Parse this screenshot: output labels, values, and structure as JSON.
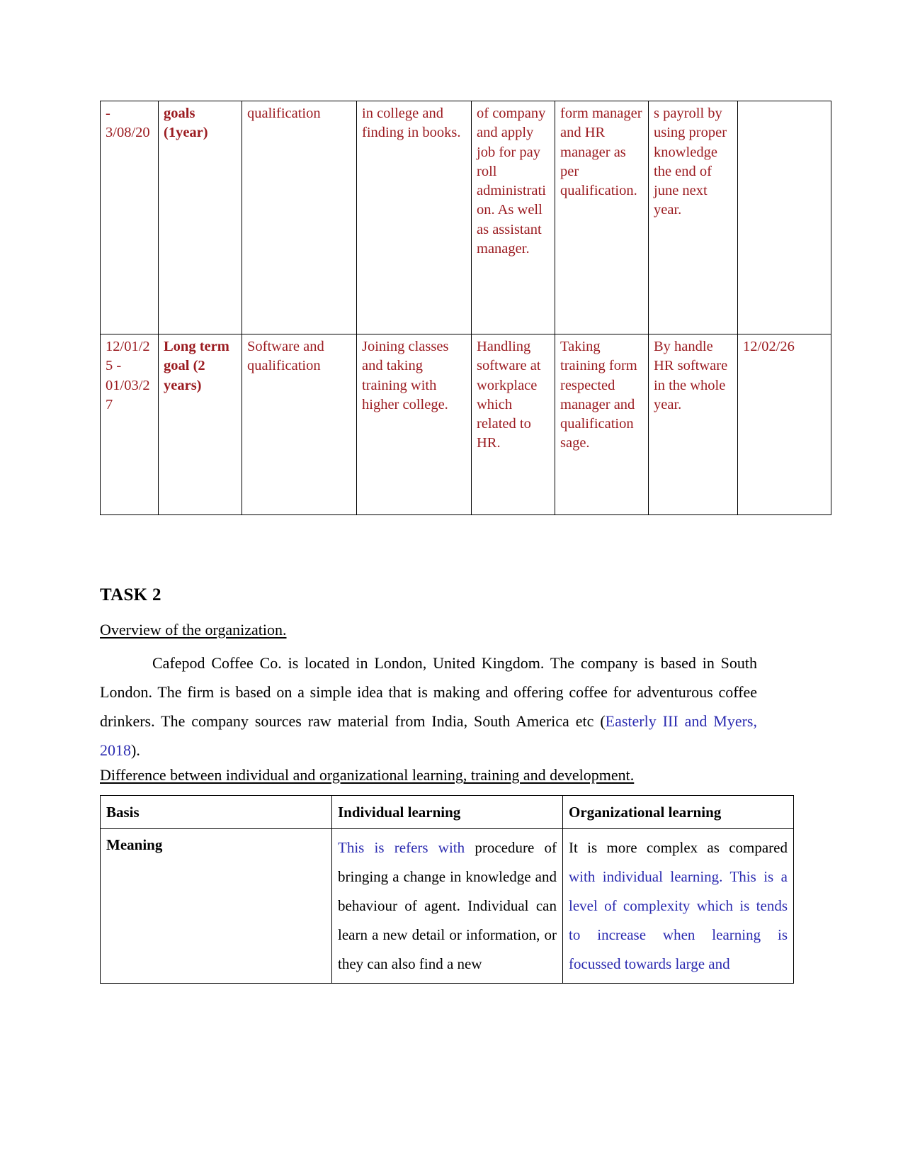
{
  "goals_table": {
    "rows": [
      {
        "name": "short-term-goal-row",
        "cells": [
          "-\n3/08/20",
          "goals (1year)",
          "qualification",
          "in college and finding in books.",
          "of company and apply job for pay roll administration. As well as assistant manager.",
          "form manager and HR manager as per qualification.",
          "s payroll by using proper knowledge the end of june next year.",
          ""
        ]
      },
      {
        "name": "long-term-goal-row",
        "cells": [
          "12/01/25 - 01/03/27",
          "Long term goal (2 years)",
          "Software and qualification",
          "Joining classes and taking training with higher college.",
          "Handling software at workplace which related to HR.",
          "Taking training form respected manager and qualification sage.",
          "By handle HR software in the whole year.",
          "12/02/26"
        ]
      }
    ]
  },
  "task": {
    "title": "TASK 2",
    "overview_heading": "Overview of the organization.",
    "overview_paragraph_part1": "Cafepod Coffee Co. is located in London, United Kingdom. The company is based in South London. The firm is based on a simple idea that is making and offering coffee for adventurous coffee drinkers. The company sources raw material from India, South America etc (",
    "citation": "Easterly III and Myers, 2018",
    "overview_paragraph_part2": ").",
    "difference_heading": "Difference between individual and organizational learning, training and development."
  },
  "learning_table": {
    "headers": [
      "Basis",
      "Individual learning",
      "Organizational learning"
    ],
    "rows": [
      {
        "basis": "Meaning",
        "individual_blue": "This is refers with",
        "individual_black": " procedure of bringing a change in knowledge and behaviour of agent. Individual can learn a new detail or information, or they can also find a new",
        "organizational_black": "It is more complex as compared ",
        "organizational_blue": "with individual learning. This is a level of complexity which is tends to increase when learning is focussed towards large and"
      }
    ]
  },
  "colors": {
    "maroon": "#9b1b20",
    "blue": "#2b2bb0",
    "black": "#000000"
  }
}
